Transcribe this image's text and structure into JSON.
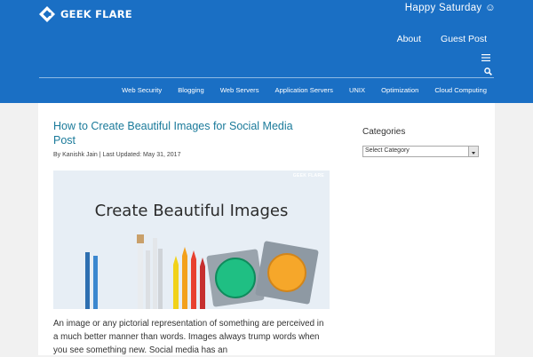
{
  "site": {
    "brand": "GEEK FLARE",
    "greeting": "Happy  Saturday ☺",
    "top_links": [
      "About",
      "Guest Post"
    ],
    "nav": [
      "Web Security",
      "Blogging",
      "Web Servers",
      "Application Servers",
      "UNIX",
      "Optimization",
      "Cloud Computing"
    ],
    "brand_color": "#1a6fc4"
  },
  "article": {
    "title": "How to Create Beautiful Images for Social Media Post",
    "byline": "By Kanishk Jain | Last Updated: May 31, 2017",
    "hero": {
      "text": "Create Beautiful Images",
      "brand": "GEEK FLARE"
    },
    "excerpt": "An image or any pictorial representation of something are perceived in a much better manner than words. Images always trump words when you see something new. Social media has an"
  },
  "sidebar": {
    "title": "Categories",
    "select_value": "Select Category"
  },
  "icons": {
    "menu": "hamburger-icon",
    "search": "search-icon",
    "logo": "geekflare-logo-icon"
  }
}
